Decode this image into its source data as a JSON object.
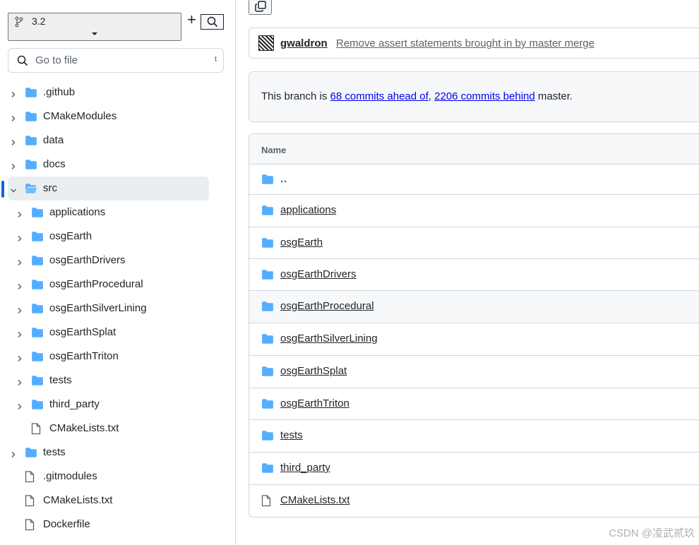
{
  "sidebar": {
    "branch_name": "3.2",
    "add_label": "+",
    "goto_placeholder": "Go to file",
    "goto_shortcut": "t",
    "tree": [
      {
        "label": ".github",
        "type": "folder",
        "depth": 0,
        "expanded": false,
        "active": false
      },
      {
        "label": "CMakeModules",
        "type": "folder",
        "depth": 0,
        "expanded": false,
        "active": false
      },
      {
        "label": "data",
        "type": "folder",
        "depth": 0,
        "expanded": false,
        "active": false
      },
      {
        "label": "docs",
        "type": "folder",
        "depth": 0,
        "expanded": false,
        "active": false
      },
      {
        "label": "src",
        "type": "folder",
        "depth": 0,
        "expanded": true,
        "active": true
      },
      {
        "label": "applications",
        "type": "folder",
        "depth": 1,
        "expanded": false,
        "active": false
      },
      {
        "label": "osgEarth",
        "type": "folder",
        "depth": 1,
        "expanded": false,
        "active": false
      },
      {
        "label": "osgEarthDrivers",
        "type": "folder",
        "depth": 1,
        "expanded": false,
        "active": false
      },
      {
        "label": "osgEarthProcedural",
        "type": "folder",
        "depth": 1,
        "expanded": false,
        "active": false
      },
      {
        "label": "osgEarthSilverLining",
        "type": "folder",
        "depth": 1,
        "expanded": false,
        "active": false
      },
      {
        "label": "osgEarthSplat",
        "type": "folder",
        "depth": 1,
        "expanded": false,
        "active": false
      },
      {
        "label": "osgEarthTriton",
        "type": "folder",
        "depth": 1,
        "expanded": false,
        "active": false
      },
      {
        "label": "tests",
        "type": "folder",
        "depth": 1,
        "expanded": false,
        "active": false
      },
      {
        "label": "third_party",
        "type": "folder",
        "depth": 1,
        "expanded": false,
        "active": false
      },
      {
        "label": "CMakeLists.txt",
        "type": "file",
        "depth": 1,
        "expanded": false,
        "active": false
      },
      {
        "label": "tests",
        "type": "folder",
        "depth": 0,
        "expanded": false,
        "active": false
      },
      {
        "label": ".gitmodules",
        "type": "file",
        "depth": 0,
        "expanded": false,
        "active": false
      },
      {
        "label": "CMakeLists.txt",
        "type": "file",
        "depth": 0,
        "expanded": false,
        "active": false
      },
      {
        "label": "Dockerfile",
        "type": "file",
        "depth": 0,
        "expanded": false,
        "active": false
      }
    ]
  },
  "commit": {
    "author": "gwaldron",
    "message": "Remove assert statements brought in by master merge"
  },
  "branch_status": {
    "prefix": "This branch is ",
    "ahead": "68 commits ahead of",
    "separator": ", ",
    "behind": "2206 commits behind",
    "suffix": " master."
  },
  "files": {
    "header": "Name",
    "rows": [
      {
        "name": "..",
        "type": "up"
      },
      {
        "name": "applications",
        "type": "folder"
      },
      {
        "name": "osgEarth",
        "type": "folder"
      },
      {
        "name": "osgEarthDrivers",
        "type": "folder"
      },
      {
        "name": "osgEarthProcedural",
        "type": "folder",
        "hover": true
      },
      {
        "name": "osgEarthSilverLining",
        "type": "folder"
      },
      {
        "name": "osgEarthSplat",
        "type": "folder"
      },
      {
        "name": "osgEarthTriton",
        "type": "folder"
      },
      {
        "name": "tests",
        "type": "folder"
      },
      {
        "name": "third_party",
        "type": "folder"
      },
      {
        "name": "CMakeLists.txt",
        "type": "file"
      }
    ]
  },
  "colors": {
    "folder": "#54aeff",
    "link": "#0000ee",
    "accent": "#0969da"
  },
  "watermark": "CSDN @凌武贰玖"
}
